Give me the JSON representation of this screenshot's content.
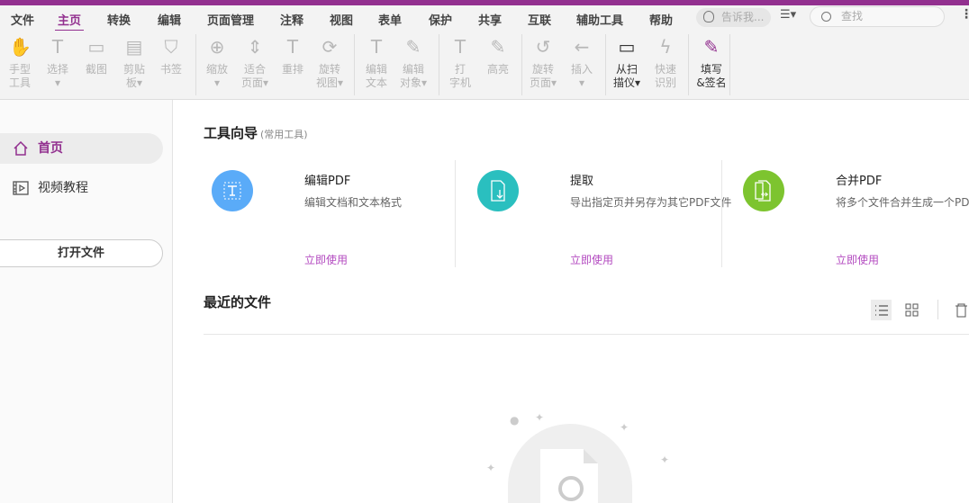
{
  "menu": {
    "items": [
      "文件",
      "主页",
      "转换",
      "编辑",
      "页面管理",
      "注释",
      "视图",
      "表单",
      "保护",
      "共享",
      "互联",
      "辅助工具",
      "帮助"
    ],
    "active": "主页",
    "tell_me": "告诉我...",
    "search_placeholder": "查找"
  },
  "ribbon": {
    "tools": [
      {
        "label1": "手型",
        "label2": "工具",
        "icon": "hand-icon"
      },
      {
        "label1": "选择",
        "label2": "▾",
        "icon": "select-text-icon"
      },
      {
        "label1": "截图",
        "label2": "",
        "icon": "snapshot-icon"
      },
      {
        "label1": "剪贴",
        "label2": "板▾",
        "icon": "clipboard-icon"
      },
      {
        "label1": "书签",
        "label2": "",
        "icon": "bookmark-icon"
      },
      {
        "label1": "缩放",
        "label2": "▾",
        "icon": "zoom-icon"
      },
      {
        "label1": "适合",
        "label2": "页面▾",
        "icon": "fit-page-icon"
      },
      {
        "label1": "重排",
        "label2": "",
        "icon": "reflow-icon"
      },
      {
        "label1": "旋转",
        "label2": "视图▾",
        "icon": "rotate-view-icon"
      },
      {
        "label1": "编辑",
        "label2": "文本",
        "icon": "edit-text-icon"
      },
      {
        "label1": "编辑",
        "label2": "对象▾",
        "icon": "edit-object-icon"
      },
      {
        "label1": "打",
        "label2": "字机",
        "icon": "typewriter-icon"
      },
      {
        "label1": "高亮",
        "label2": "",
        "icon": "highlight-icon"
      },
      {
        "label1": "旋转",
        "label2": "页面▾",
        "icon": "rotate-page-icon"
      },
      {
        "label1": "插入",
        "label2": "▾",
        "icon": "insert-icon"
      },
      {
        "label1": "从扫",
        "label2": "描仪▾",
        "icon": "scanner-icon"
      },
      {
        "label1": "快速",
        "label2": "识别",
        "icon": "ocr-icon"
      },
      {
        "label1": "填写",
        "label2": "&签名",
        "icon": "fill-sign-icon"
      }
    ]
  },
  "sidebar": {
    "home": "首页",
    "tutorial": "视频教程",
    "open_file": "打开文件"
  },
  "main": {
    "tools_title": "工具向导",
    "tools_sub": "(常用工具)",
    "cards": [
      {
        "title": "编辑PDF",
        "desc": "编辑文档和文本格式",
        "link": "立即使用",
        "color": "#5aabf8"
      },
      {
        "title": "提取",
        "desc": "导出指定页并另存为其它PDF文件",
        "link": "立即使用",
        "color": "#2abfbf"
      },
      {
        "title": "合并PDF",
        "desc": "将多个文件合并生成一个PDF文件",
        "link": "立即使用",
        "color": "#7dc42f"
      }
    ],
    "recent_title": "最近的文件"
  }
}
